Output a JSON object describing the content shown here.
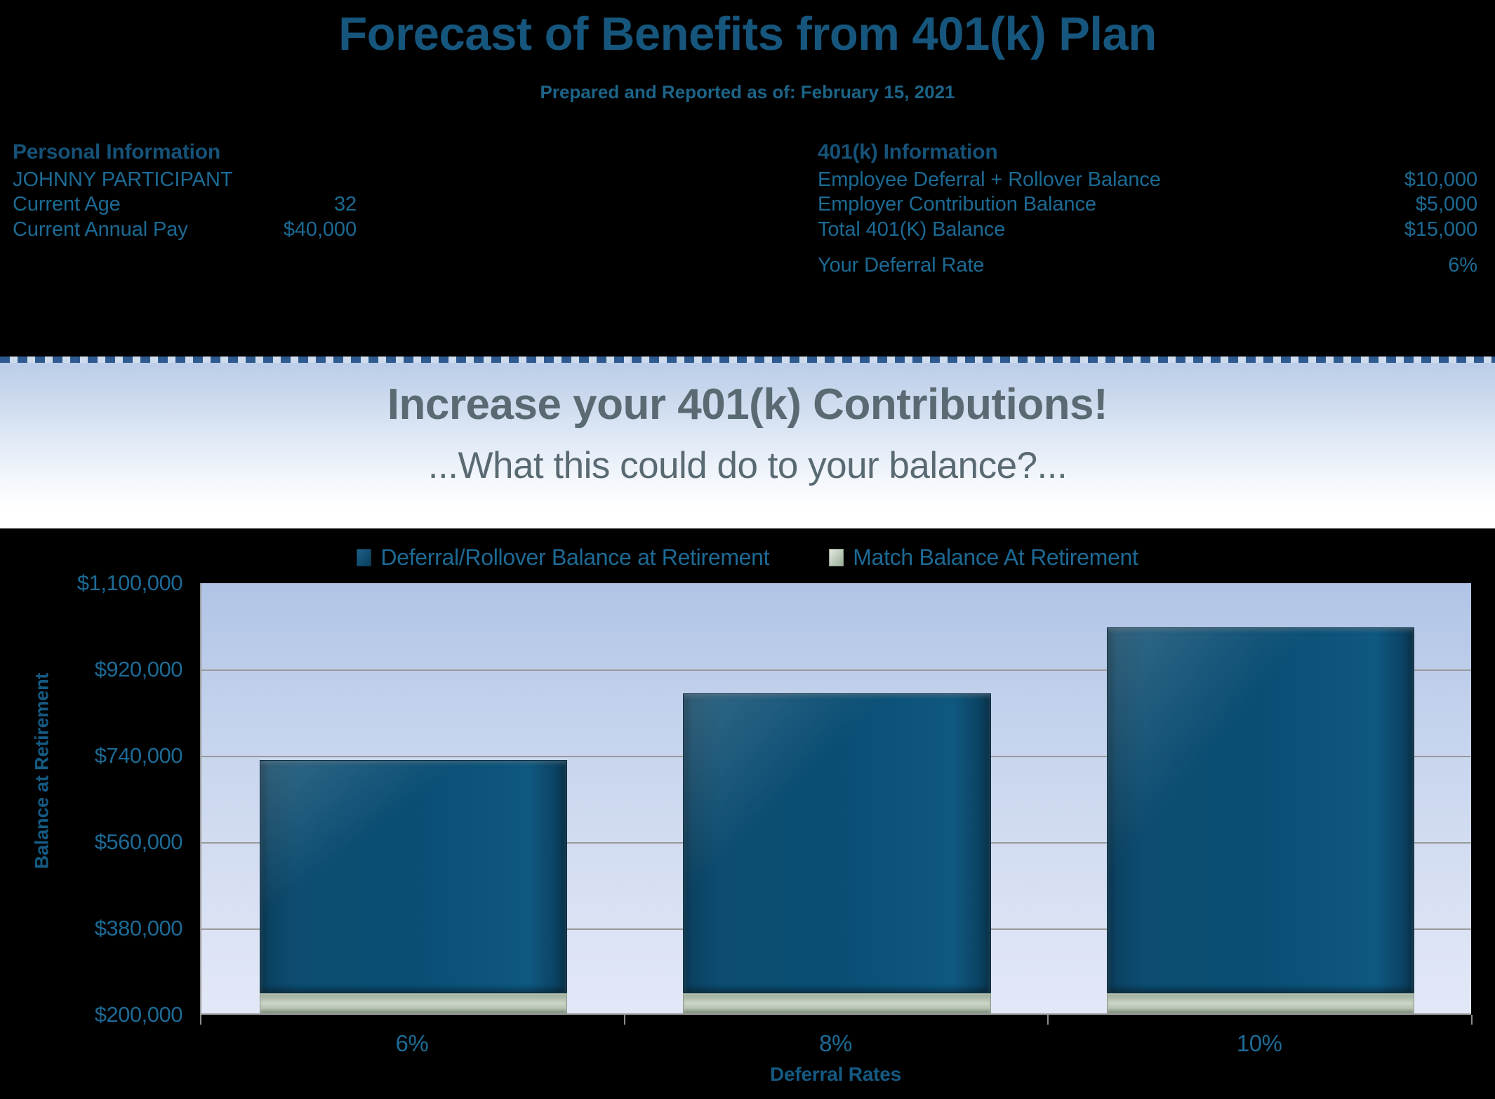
{
  "header": {
    "title": "Forecast of Benefits from 401(k) Plan",
    "subtitle": "Prepared and Reported as of: February 15, 2021",
    "personal": {
      "heading": "Personal Information",
      "name": "JOHNNY PARTICIPANT",
      "rows": [
        {
          "label": "Current Age",
          "value": "32"
        },
        {
          "label": "Current Annual Pay",
          "value": "$40,000"
        }
      ]
    },
    "plan": {
      "heading": "401(k) Information",
      "rows": [
        {
          "label": "Employee Deferral + Rollover Balance",
          "value": "$10,000"
        },
        {
          "label": "Employer Contribution Balance",
          "value": "$5,000"
        },
        {
          "label": "Total 401(K) Balance",
          "value": "$15,000"
        },
        {
          "label": "Your Deferral Rate",
          "value": "6%"
        }
      ]
    }
  },
  "banner": {
    "title": "Increase your 401(k) Contributions!",
    "subtitle": "...What this could do to your balance?..."
  },
  "chart_data": {
    "type": "bar",
    "stacked": true,
    "title": "",
    "xlabel": "Deferral Rates",
    "ylabel": "Balance at Retirement",
    "categories": [
      "6%",
      "8%",
      "10%"
    ],
    "ylim": [
      200000,
      1100000
    ],
    "ytick_labels": [
      "$1,100,000",
      "$920,000",
      "$740,000",
      "$560,000",
      "$380,000",
      "$200,000"
    ],
    "ytick_values": [
      1100000,
      920000,
      740000,
      560000,
      380000,
      200000
    ],
    "grid": true,
    "legend_position": "top",
    "series": [
      {
        "name": "Deferral/Rollover Balance at Retirement",
        "color": "#0d4d71",
        "values": [
          685000,
          825000,
          962000
        ]
      },
      {
        "name": "Match Balance At Retirement",
        "color": "#b6c3b2",
        "values": [
          43000,
          43000,
          43000
        ]
      }
    ],
    "totals": [
      728000,
      868000,
      1005000
    ]
  }
}
